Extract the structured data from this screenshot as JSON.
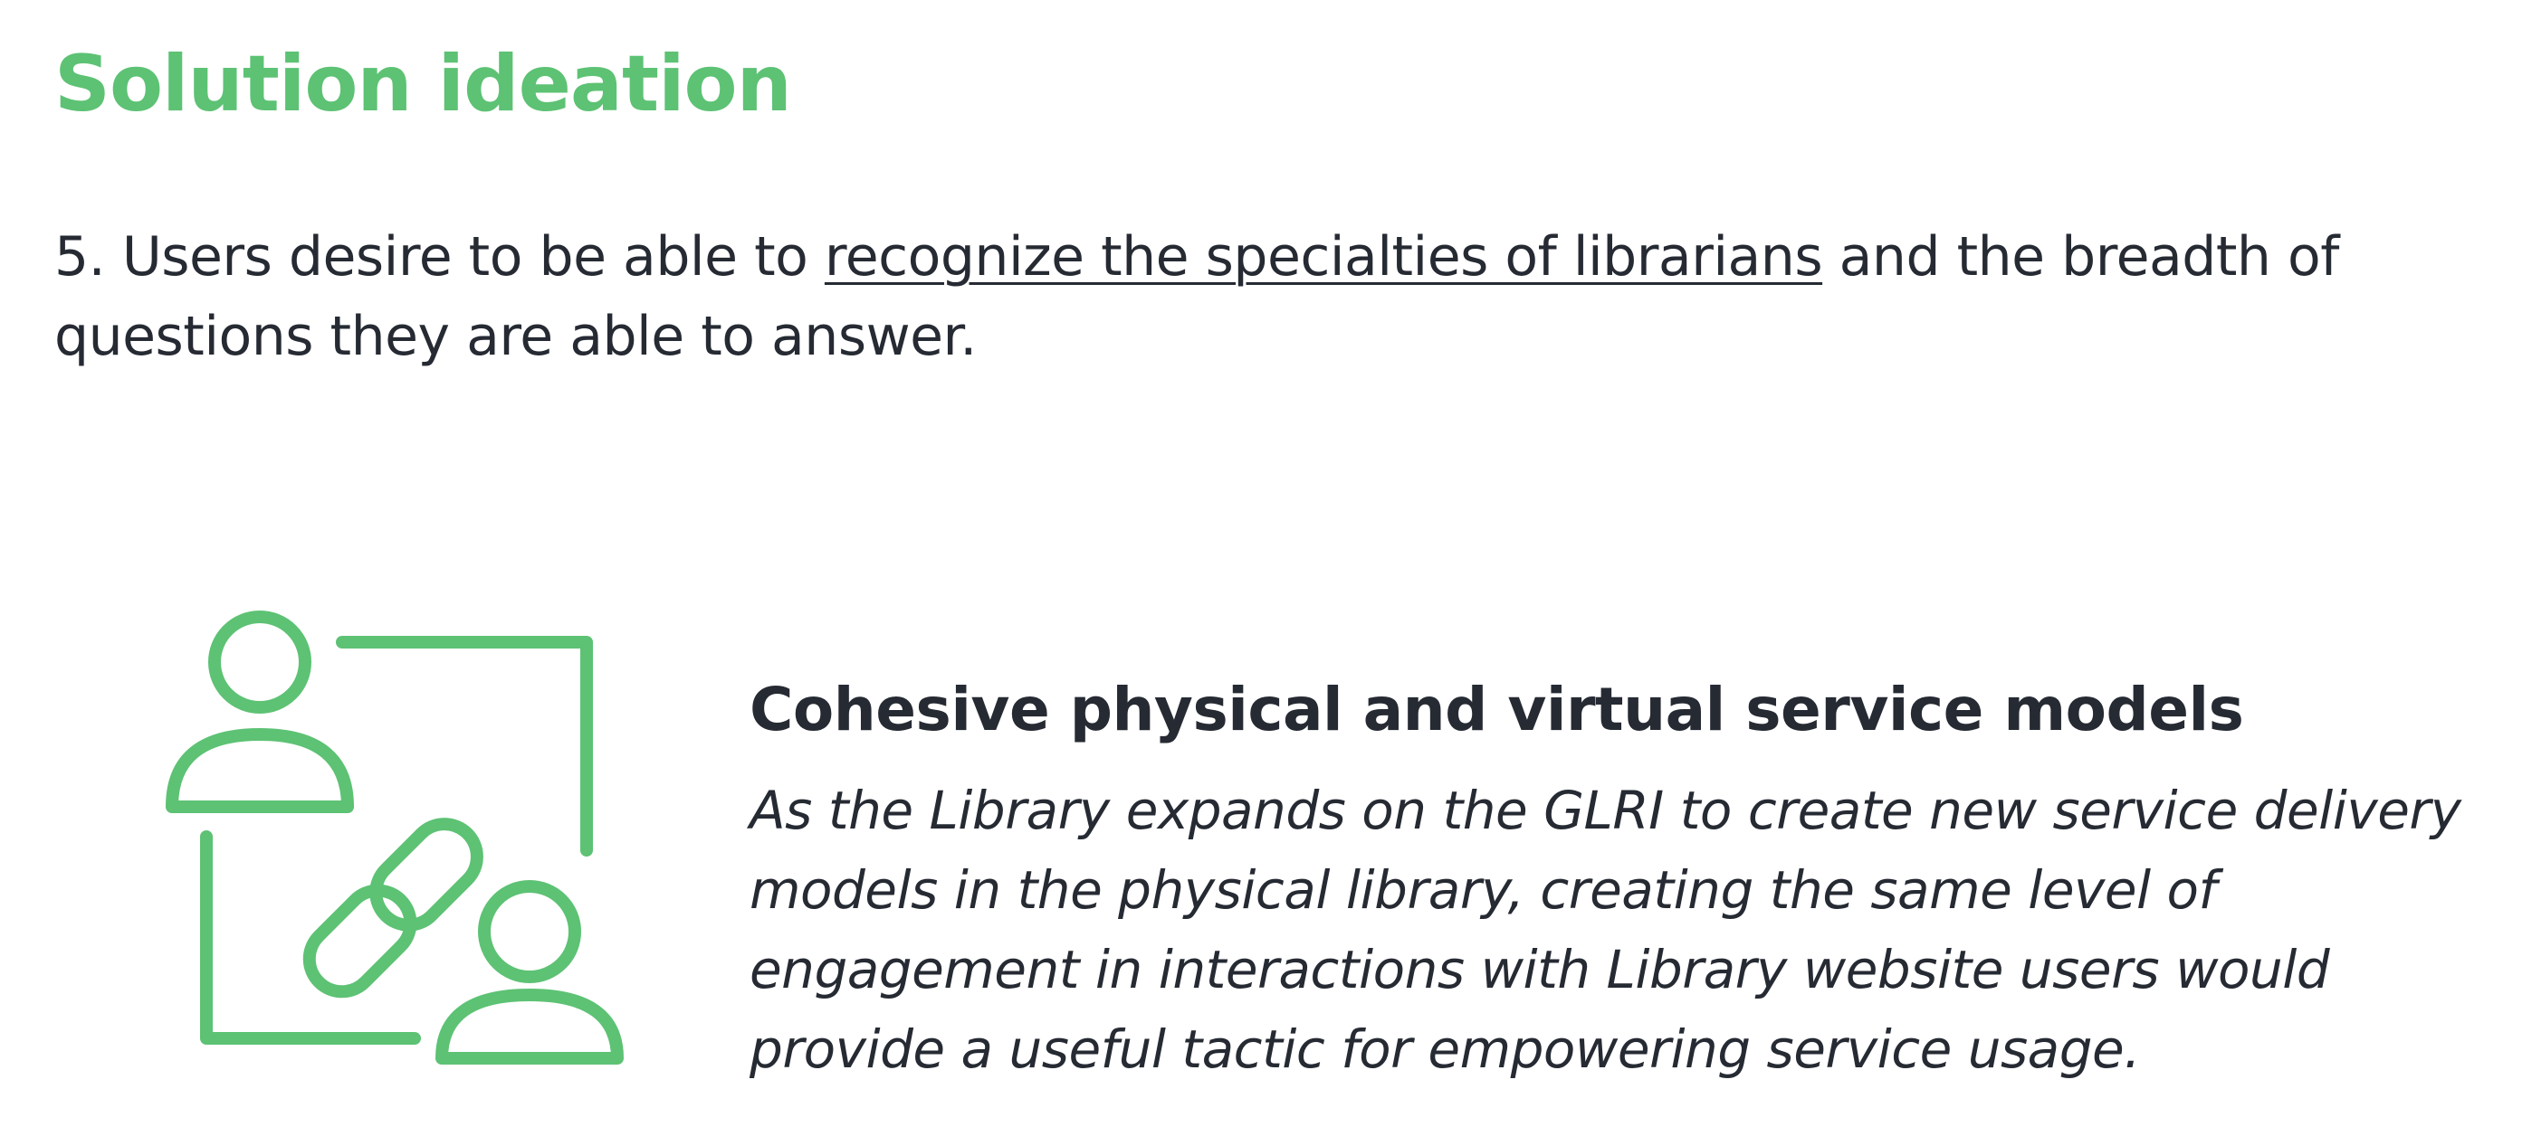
{
  "page": {
    "title": "Solution ideation",
    "accent_color": "#5dc274",
    "text_color": "#262a33"
  },
  "insight": {
    "prefix": "5. Users desire to be able to ",
    "highlight": "recognize the specialties of librarians",
    "suffix": " and the breadth of questions they are able to answer."
  },
  "card": {
    "icon": "connected-users-link-icon",
    "title": "Cohesive physical and virtual service models",
    "description": "As the Library expands on the GLRI to create new service delivery models in the physical library, creating the same level of engagement in interactions with Library website users would provide a useful tactic for empowering service usage."
  }
}
